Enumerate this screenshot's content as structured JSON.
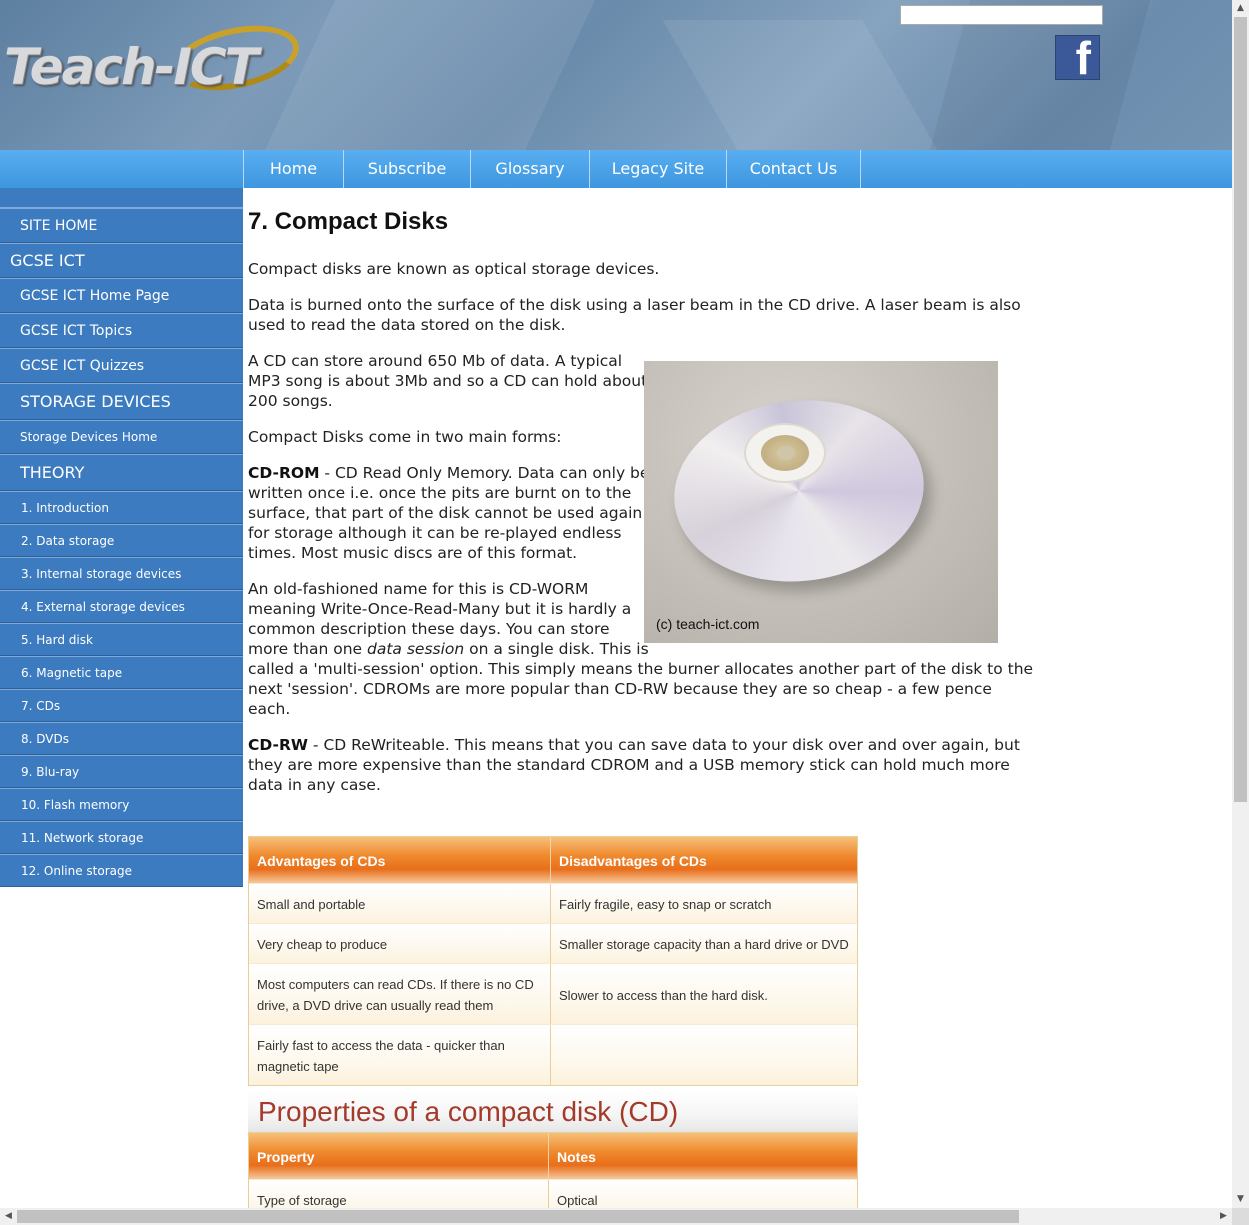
{
  "header": {
    "logo_text": "Teach-ICT",
    "search_placeholder": "",
    "facebook_icon": "facebook-icon",
    "facebook_glyph": "f"
  },
  "nav": {
    "items": [
      {
        "label": "Home"
      },
      {
        "label": "Subscribe"
      },
      {
        "label": "Glossary"
      },
      {
        "label": "Legacy Site"
      },
      {
        "label": "Contact Us"
      }
    ]
  },
  "sidebar": {
    "site_home": "SITE HOME",
    "gcse_heading": "GCSE ICT",
    "gcse_links": [
      "GCSE ICT Home Page",
      "GCSE ICT Topics",
      "GCSE ICT Quizzes"
    ],
    "storage_heading": "STORAGE DEVICES",
    "storage_home": "Storage Devices Home",
    "theory_heading": "THEORY",
    "theory_links": [
      "1. Introduction",
      "2. Data storage",
      "3. Internal storage devices",
      "4. External storage devices",
      "5. Hard disk",
      "6. Magnetic tape",
      "7. CDs",
      "8. DVDs",
      "9. Blu-ray",
      "10. Flash memory",
      "11. Network storage",
      "12. Online storage"
    ]
  },
  "main": {
    "title": "7. Compact Disks",
    "p1": "Compact disks are known as optical storage devices.",
    "p2_line1": "Data is burned onto the surface of the disk using a laser beam in the CD drive. A laser beam is also",
    "p2_line2": "used to read the data stored on the disk.",
    "p3_line1": "A CD can store around 650 Mb of data. A typical",
    "p3_line2": "MP3 song is about 3Mb and so a CD can hold about",
    "p3_line3": "200 songs.",
    "p4": "Compact Disks come in two main forms:",
    "cdrom_term": "CD-ROM",
    "cdrom_line1": " - CD Read Only Memory. Data can only be",
    "cdrom_line2": "written once i.e. once the pits are burnt on to the",
    "cdrom_line3": "surface, that part of the disk cannot be used again",
    "cdrom_line4": "for storage although it can be re-played endless",
    "cdrom_line5": "times. Most music discs are of this format.",
    "worm_line1": "An old-fashioned name for this is CD-WORM",
    "worm_line2": "meaning Write-Once-Read-Many but it is hardly a",
    "worm_line3": "common description these days. You can store",
    "worm_line4a": "more than one ",
    "worm_line4_italic": "data session",
    "worm_line4b": " on a single disk. This is",
    "worm_line5": "called a 'multi-session' option. This simply means the burner allocates another part of the disk to the",
    "worm_line6": "next 'session'. CDROMs are more popular than CD-RW because they are so cheap - a few pence",
    "worm_line7": "each.",
    "cdrw_term": "CD-RW",
    "cdrw_line1": " - CD ReWriteable. This means that you can save data to your disk over and over again, but",
    "cdrw_line2": "they are more expensive than the standard CDROM and a USB memory stick can hold much more",
    "cdrw_line3": "data in any case.",
    "photo_caption": "(c) teach-ict.com"
  },
  "adv_table": {
    "headers": [
      "Advantages of CDs",
      "Disadvantages of CDs"
    ],
    "rows": [
      [
        "Small and portable",
        "Fairly fragile, easy to snap or scratch"
      ],
      [
        "Very cheap to produce",
        "Smaller storage capacity than a hard drive or DVD"
      ],
      [
        "Most computers can read CDs. If there is no CD drive, a DVD drive can usually read them",
        "Slower to access than the hard disk."
      ],
      [
        "Fairly fast to access the data - quicker than magnetic tape",
        ""
      ]
    ]
  },
  "props": {
    "title": "Properties of a compact disk (CD)",
    "headers": [
      "Property",
      "Notes"
    ],
    "rows": [
      [
        "Type of storage",
        "Optical"
      ]
    ]
  },
  "scrollbars": {
    "up": "▲",
    "down": "▼",
    "left": "◀",
    "right": "▶"
  }
}
